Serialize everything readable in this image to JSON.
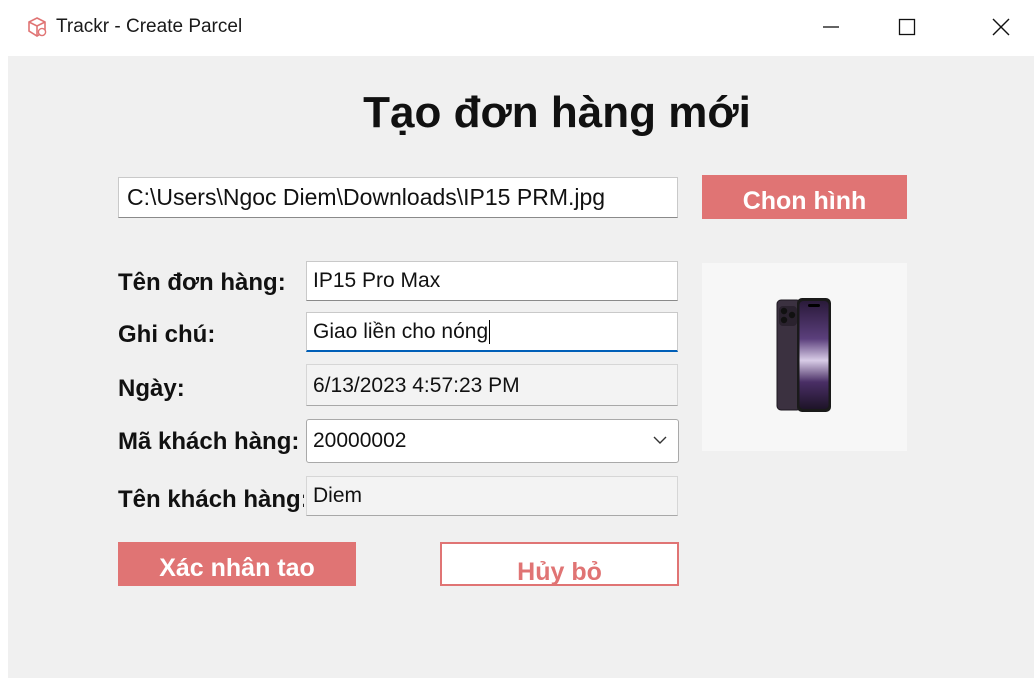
{
  "window": {
    "title": "Trackr - Create Parcel",
    "icon": "parcel-box-icon",
    "controls": [
      "minimize-icon",
      "maximize-icon",
      "close-icon"
    ]
  },
  "form": {
    "heading": "Tạo đơn hàng mới",
    "image_path": "C:\\Users\\Ngoc Diem\\Downloads\\IP15 PRM.jpg",
    "choose_image_label": "Chon hình",
    "fields": {
      "order_name_label": "Tên đơn hàng:",
      "order_name_value": "IP15 Pro Max",
      "note_label": "Ghi chú:",
      "note_value": "Giao liền cho nóng",
      "date_label": "Ngày:",
      "date_value": "6/13/2023 4:57:23 PM",
      "customer_id_label": "Mã khách hàng:",
      "customer_id_value": "20000002",
      "customer_name_label": "Tên khách hàng:",
      "customer_name_value": "Diem"
    },
    "confirm_label": "Xác nhân tao",
    "cancel_label": "Hủy bỏ",
    "preview_image": "iphone-pro-max-image"
  },
  "colors": {
    "accent": "#e07474",
    "focus": "#005fb8",
    "background": "#f0f0f0"
  }
}
